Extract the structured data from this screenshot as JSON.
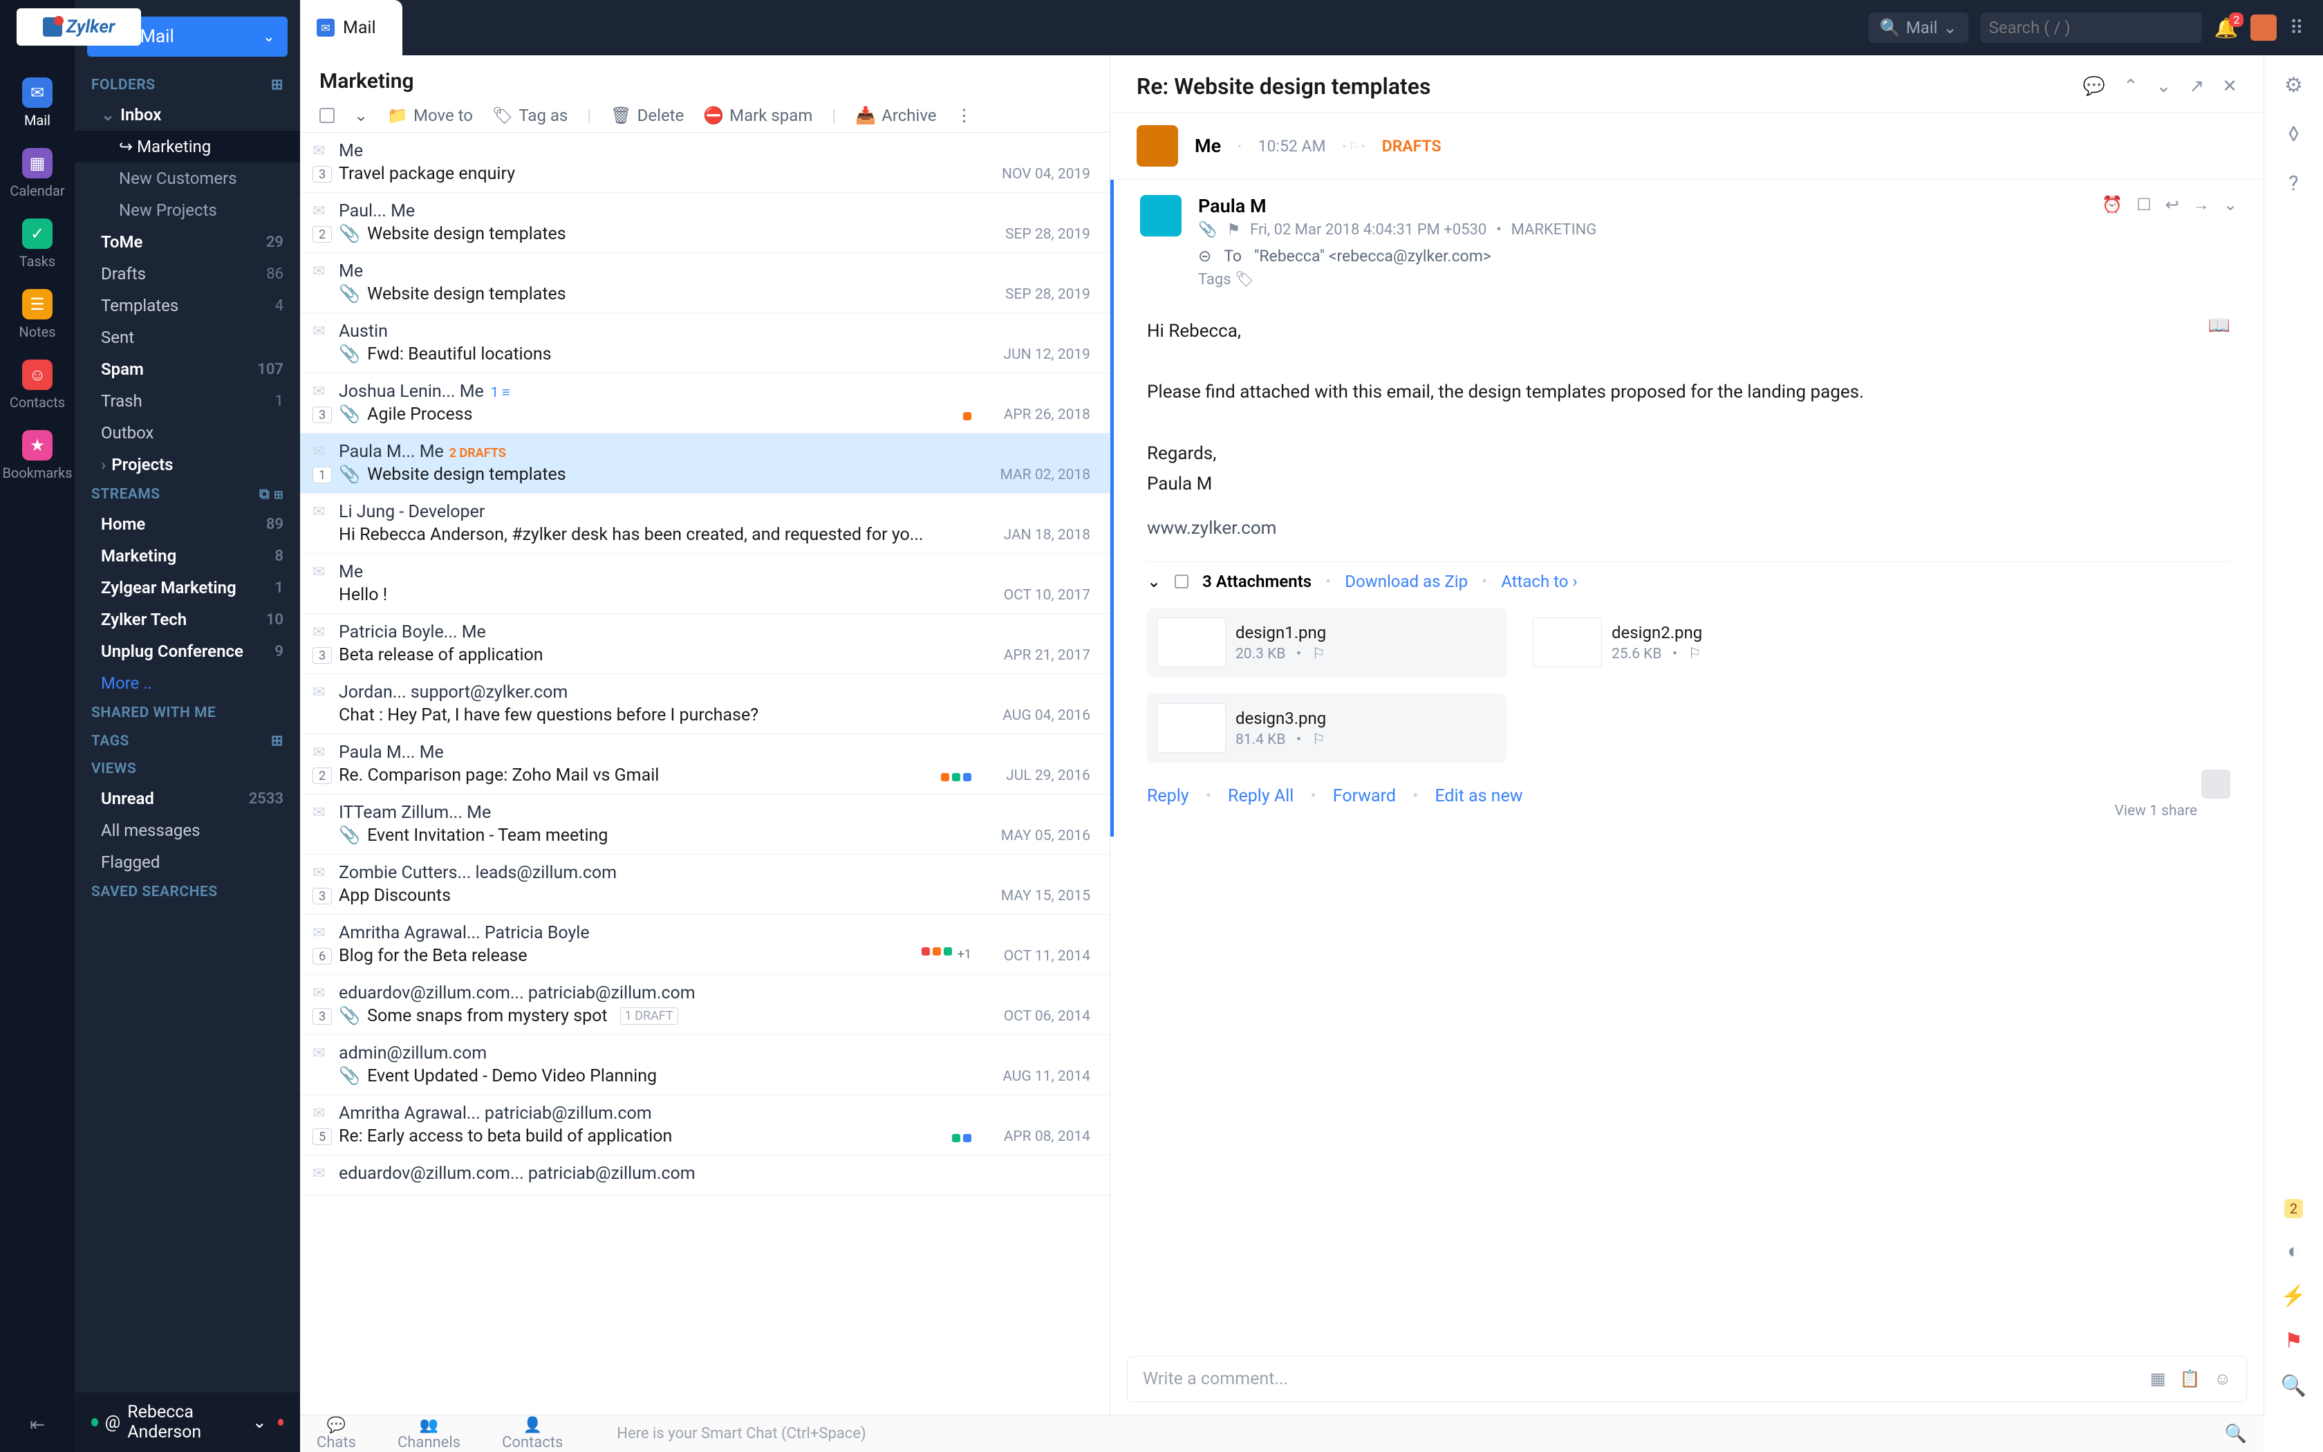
{
  "brand": {
    "name": "Zylker"
  },
  "rail": [
    {
      "label": "Mail",
      "icon": "✉"
    },
    {
      "label": "Calendar",
      "icon": "▦"
    },
    {
      "label": "Tasks",
      "icon": "✓"
    },
    {
      "label": "Notes",
      "icon": "☰"
    },
    {
      "label": "Contacts",
      "icon": "☺"
    },
    {
      "label": "Bookmarks",
      "icon": "★"
    }
  ],
  "sidebar": {
    "new_mail": "New Mail",
    "folders_head": "FOLDERS",
    "folders": [
      {
        "label": "Inbox",
        "count": "",
        "children": [
          {
            "label": "Marketing",
            "active": true
          },
          {
            "label": "New Customers"
          },
          {
            "label": "New Projects"
          }
        ]
      },
      {
        "label": "ToMe",
        "count": "29",
        "bold": true
      },
      {
        "label": "Drafts",
        "count": "86"
      },
      {
        "label": "Templates",
        "count": "4"
      },
      {
        "label": "Sent",
        "count": ""
      },
      {
        "label": "Spam",
        "count": "107",
        "bold": true
      },
      {
        "label": "Trash",
        "count": "1"
      },
      {
        "label": "Outbox",
        "count": ""
      },
      {
        "label": "Projects",
        "count": "",
        "chev": true
      }
    ],
    "streams_head": "STREAMS",
    "streams": [
      {
        "label": "Home",
        "count": "89"
      },
      {
        "label": "Marketing",
        "count": "8"
      },
      {
        "label": "Zylgear Marketing",
        "count": "1"
      },
      {
        "label": "Zylker Tech",
        "count": "10"
      },
      {
        "label": "Unplug Conference",
        "count": "9"
      }
    ],
    "more": "More ..",
    "shared_head": "SHARED WITH ME",
    "tags_head": "TAGS",
    "views_head": "VIEWS",
    "views": [
      {
        "label": "Unread",
        "count": "2533",
        "bold": true
      },
      {
        "label": "All messages"
      },
      {
        "label": "Flagged"
      }
    ],
    "saved_head": "SAVED SEARCHES",
    "user": "Rebecca Anderson"
  },
  "topbar": {
    "tab": "Mail",
    "scope": "Mail",
    "search_ph": "Search ( / )"
  },
  "list": {
    "title": "Marketing",
    "toolbar": {
      "moveto": "Move to",
      "tagas": "Tag as",
      "delete": "Delete",
      "markspam": "Mark spam",
      "archive": "Archive"
    },
    "rows": [
      {
        "from": "Me",
        "subj": "Travel package enquiry",
        "date": "NOV 04, 2019",
        "badge": "3"
      },
      {
        "from": "Paul... Me",
        "subj": "Website design templates",
        "date": "SEP 28, 2019",
        "badge": "2",
        "clip": true
      },
      {
        "from": "Me",
        "subj": "Website design templates",
        "date": "SEP 28, 2019",
        "clip": true
      },
      {
        "from": "Austin",
        "subj": "Fwd: Beautiful locations",
        "date": "JUN 12, 2019",
        "clip": true
      },
      {
        "from": "Joshua Lenin... Me",
        "subj": "Agile Process",
        "date": "APR 26, 2018",
        "badge": "3",
        "clip": true,
        "dots": [
          "#f97316"
        ],
        "extra": "1 ≡"
      },
      {
        "from": "Paula M... Me",
        "subj": "Website design templates",
        "date": "MAR 02, 2018",
        "badge": "1",
        "clip": true,
        "tag": "2 DRAFTS",
        "selected": true
      },
      {
        "from": "Li Jung - Developer",
        "subj": "Hi Rebecca Anderson, #zylker desk has been created, and requested for yo...",
        "date": "JAN 18, 2018"
      },
      {
        "from": "Me",
        "subj": "Hello !",
        "date": "OCT 10, 2017"
      },
      {
        "from": "Patricia Boyle... Me",
        "subj": "Beta release of application",
        "date": "APR 21, 2017",
        "badge": "3"
      },
      {
        "from": "Jordan... support@zylker.com",
        "subj": "Chat : Hey Pat, I have few questions before I purchase?",
        "date": "AUG 04, 2016"
      },
      {
        "from": "Paula M... Me",
        "subj": "Re. Comparison page: Zoho Mail vs Gmail",
        "date": "JUL 29, 2016",
        "badge": "2",
        "flag": true,
        "dots": [
          "#f97316",
          "#10b981",
          "#3b82f6"
        ]
      },
      {
        "from": "ITTeam Zillum... Me",
        "subj": "Event Invitation - Team meeting",
        "date": "MAY 05, 2016",
        "clip": true
      },
      {
        "from": "Zombie Cutters... leads@zillum.com",
        "subj": "App Discounts",
        "date": "MAY 15, 2015",
        "badge": "3",
        "flag": true,
        "flagc": "#3b82f6"
      },
      {
        "from": "Amritha Agrawal... Patricia Boyle",
        "subj": "Blog for the Beta release",
        "date": "OCT 11, 2014",
        "badge": "6",
        "flag": true,
        "dots": [
          "#ef4444",
          "#f97316",
          "#10b981"
        ],
        "plus": "+1"
      },
      {
        "from": "eduardov@zillum.com... patriciab@zillum.com",
        "subj": "Some snaps from mystery spot",
        "date": "OCT 06, 2014",
        "badge": "3",
        "clip": true,
        "tag2": "1 DRAFT"
      },
      {
        "from": "admin@zillum.com",
        "subj": "Event Updated - Demo Video Planning",
        "date": "AUG 11, 2014",
        "clip": true
      },
      {
        "from": "Amritha Agrawal... patriciab@zillum.com",
        "subj": "Re: Early access to beta build of application",
        "date": "APR 08, 2014",
        "badge": "5",
        "flag": true,
        "flagc": "#3b82f6",
        "dots": [
          "#10b981",
          "#3b82f6"
        ]
      },
      {
        "from": "eduardov@zillum.com... patriciab@zillum.com",
        "subj": "",
        "date": ""
      }
    ]
  },
  "reader": {
    "title": "Re: Website design templates",
    "draft": {
      "from": "Me",
      "time": "10:52 AM",
      "label": "DRAFTS"
    },
    "msg": {
      "from": "Paula M",
      "dateline": "Fri, 02 Mar 2018 4:04:31 PM +0530",
      "stream": "MARKETING",
      "to_label": "To",
      "to": "\"Rebecca\" <rebecca@zylker.com>",
      "tags_label": "Tags",
      "body_greet": "Hi Rebecca,",
      "body_line": "Please find attached with this email, the design templates proposed for the landing pages.",
      "regards": "Regards,",
      "sig": "Paula M",
      "url": "www.zylker.com"
    },
    "attachments": {
      "count_label": "3 Attachments",
      "download": "Download as Zip",
      "attach_to": "Attach to",
      "items": [
        {
          "name": "design1.png",
          "size": "20.3 KB"
        },
        {
          "name": "design2.png",
          "size": "25.6 KB"
        },
        {
          "name": "design3.png",
          "size": "81.4 KB"
        }
      ]
    },
    "actions": {
      "reply": "Reply",
      "replyall": "Reply All",
      "forward": "Forward",
      "editnew": "Edit as new"
    },
    "share": "View 1 share",
    "comment_ph": "Write a comment..."
  },
  "bottom": {
    "chats": "Chats",
    "channels": "Channels",
    "contacts": "Contacts",
    "hint": "Here is your Smart Chat (Ctrl+Space)"
  }
}
